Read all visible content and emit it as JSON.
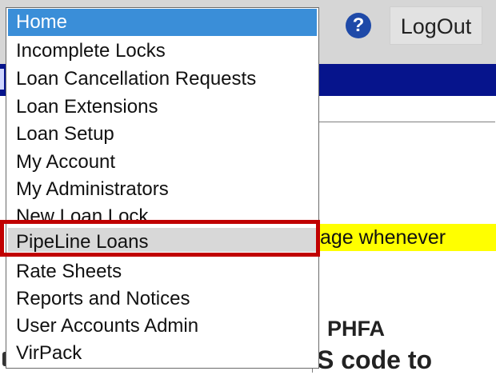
{
  "header": {
    "help_icon": "question-mark-icon",
    "help_glyph": "?",
    "logout_label": "LogOut"
  },
  "background": {
    "highlighted_fragment": "age whenever",
    "bold_fragment_1": "PHFA",
    "bold_fragment_2": "S code to"
  },
  "dropdown": {
    "selected": "Home",
    "hovered": "PipeLine Loans",
    "items": [
      "Home",
      "Incomplete Locks",
      "Loan Cancellation Requests",
      "Loan Extensions",
      "Loan Setup",
      "My Account",
      "My Administrators",
      "New Loan Lock",
      "PipeLine Loans",
      "Rate Sheets",
      "Reports and Notices",
      "User Accounts Admin",
      "VirPack"
    ]
  },
  "colors": {
    "selected_bg": "#3a8ed8",
    "hover_bg": "#d8d8d8",
    "annotation_border": "#c00000",
    "nav_bar": "#06148c",
    "highlight": "#ffff00"
  }
}
